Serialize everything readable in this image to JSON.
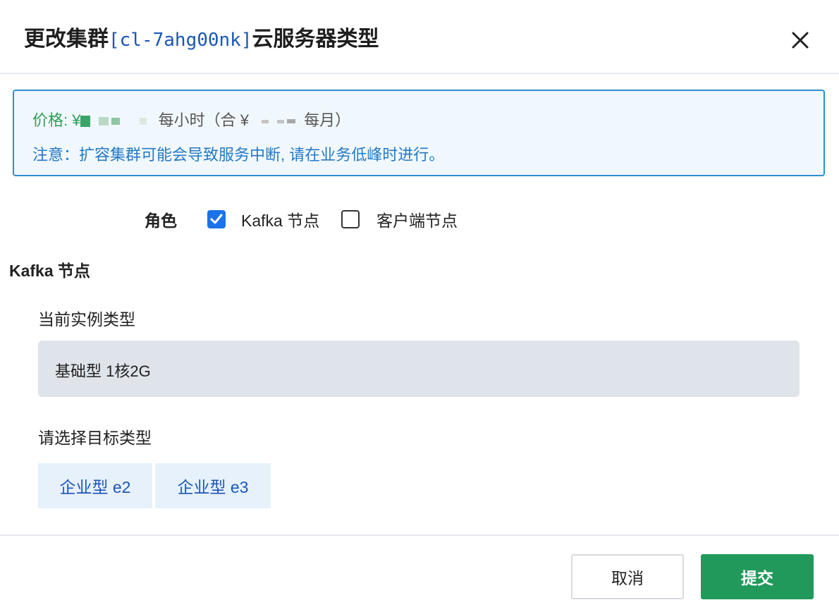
{
  "dialog": {
    "title_prefix": "更改集群",
    "cluster_id": "[cl-7ahg00nk]",
    "title_suffix": "云服务器类型",
    "close_icon": "close-icon"
  },
  "notice": {
    "price_label": "价格: ¥",
    "per_hour": "每小时（合 ¥",
    "per_month": "每月）",
    "warning": "注意：扩容集群可能会导致服务中断, 请在业务低峰时进行。"
  },
  "roles": {
    "label": "角色",
    "options": [
      {
        "label": "Kafka 节点",
        "checked": true
      },
      {
        "label": "客户端节点",
        "checked": false
      }
    ]
  },
  "kafka_section": {
    "title": "Kafka 节点",
    "current_label": "当前实例类型",
    "current_value": "基础型 1核2G",
    "target_label": "请选择目标类型",
    "target_options": [
      "企业型 e2",
      "企业型 e3"
    ]
  },
  "footer": {
    "cancel_label": "取消",
    "submit_label": "提交"
  },
  "colors": {
    "accent_blue": "#1a73e8",
    "price_green": "#2f9e59",
    "notice_border": "#2d8fd5",
    "submit_green": "#21995b"
  }
}
